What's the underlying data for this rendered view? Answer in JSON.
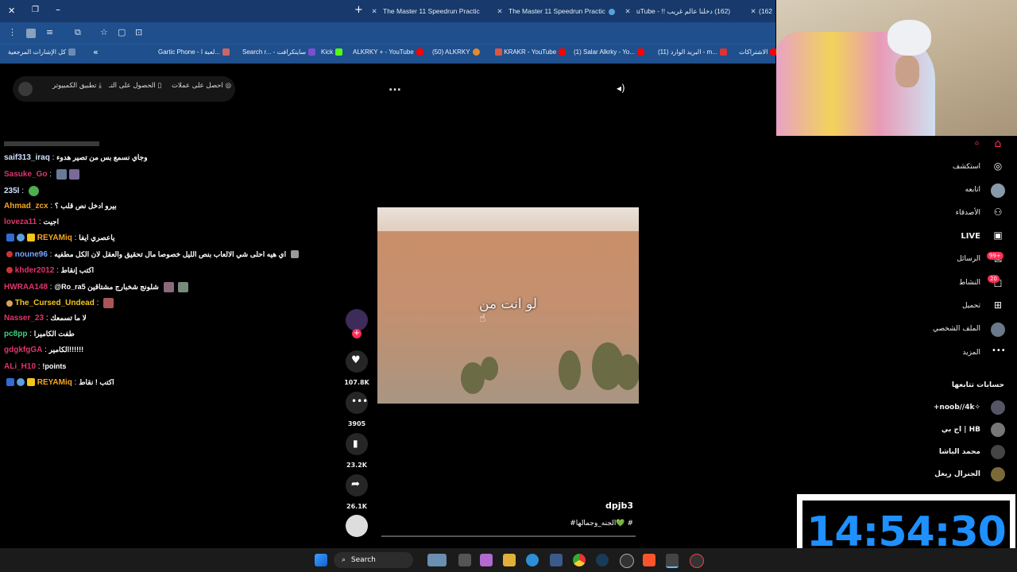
{
  "browser": {
    "tabs": [
      {
        "title": "The Master 11 Speedrun Practic"
      },
      {
        "title": "The Master 11 Speedrun Practic"
      },
      {
        "title": "uTube - ‫(162) دخلنا عالم غريب !!‬"
      },
      {
        "title": "(162"
      }
    ],
    "new_tab": "+",
    "bookmarks": [
      {
        "label": "كل الإشارات المرجعية"
      },
      {
        "label": "Gartic Phone - لعبة ا..."
      },
      {
        "label": "Search r... - سايتكرافت"
      },
      {
        "label": "Kick"
      },
      {
        "label": "ALKRKY + - YouTube"
      },
      {
        "label": "(50) ALKRKY"
      },
      {
        "label": "KRAKR - YouTube"
      },
      {
        "label": "(1) Salar Alkrky - Yo..."
      },
      {
        "label": "(11) البريد الوارد - m..."
      },
      {
        "label": "الاشتراكات"
      }
    ]
  },
  "topbar": {
    "coins": "احصل على عملات",
    "app": "الحصول على التـ",
    "desktop": "تطبيق الكمبيوتر",
    "more": "..."
  },
  "chat": [
    {
      "user": "saif313_iraq",
      "color": "#cfe3ff",
      "msg": "وجاي نسمع بس من تصير هدوء"
    },
    {
      "user": "Sasuke_Go",
      "color": "#e0356b",
      "msg": ""
    },
    {
      "user": "235l",
      "color": "#cfe3ff",
      "msg": ""
    },
    {
      "user": "Ahmad_zcx",
      "color": "#f5a623",
      "msg": "بيرو ادخل نص قلب ؟"
    },
    {
      "user": "loveza11",
      "color": "#e0356b",
      "msg": "اجيت"
    },
    {
      "user": "REYAMiq",
      "color": "#f5a623",
      "msg": "ياعصري ايفا"
    },
    {
      "user": "noune96",
      "color": "#7aa7ff",
      "msg": "اي هيه احلى شي الالعاب بنص الليل خصوصا مال تحقيق والعقل لان الكل مطفيه"
    },
    {
      "user": "khder2012",
      "color": "#e0356b",
      "msg": "اكتب إنقاط"
    },
    {
      "user": "HWRAA148",
      "color": "#e0356b",
      "msg": "@Ro_ra5 شلونج شخبارج مشتاقين"
    },
    {
      "user": "The_Cursed_Undead",
      "color": "#f5c518",
      "msg": ""
    },
    {
      "user": "Nasser_23",
      "color": "#e0356b",
      "msg": "لا ما تسمعك"
    },
    {
      "user": "pc8pp",
      "color": "#3fd07a",
      "msg": "طفت الكاميرا"
    },
    {
      "user": "gdgkfgGA",
      "color": "#e0356b",
      "msg": "الكامير!!!!!!"
    },
    {
      "user": "ALi_H10",
      "color": "#e0356b",
      "msg": "!points"
    },
    {
      "user": "REYAMiq",
      "color": "#f5a623",
      "msg": "اكتب ! نقاط"
    }
  ],
  "video": {
    "caption": "لو انت من",
    "author": "dpjb3",
    "description": "#الجنه_وجمالها💚 #"
  },
  "actions": {
    "likes": "107.8K",
    "comments": "3905",
    "saves": "23.2K",
    "shares": "26.1K"
  },
  "sidebar": {
    "items": [
      {
        "label": "استكشف",
        "icon": "compass-icon"
      },
      {
        "label": "اتابعه",
        "icon": "avatar"
      },
      {
        "label": "الأصدقاء",
        "icon": "friends-icon"
      },
      {
        "label": "LIVE",
        "icon": "live-icon"
      },
      {
        "label": "الرسائل",
        "icon": "messages-icon",
        "badge": "99+"
      },
      {
        "label": "النشاط",
        "icon": "activity-icon",
        "badge": "20"
      },
      {
        "label": "تحميل",
        "icon": "upload-icon"
      },
      {
        "label": "الملف الشخصي",
        "icon": "profile-icon"
      },
      {
        "label": "المزيد",
        "icon": "more-icon"
      }
    ],
    "following_title": "حسابات تتابعها",
    "following": [
      {
        "name": "+noob//4k✧"
      },
      {
        "name": "اج بي | HB"
      },
      {
        "name": "محمد الباشا"
      },
      {
        "name": "الجنرال ريغل"
      }
    ]
  },
  "taskbar": {
    "search": "Search"
  },
  "clock": {
    "time": "14:54:30"
  }
}
